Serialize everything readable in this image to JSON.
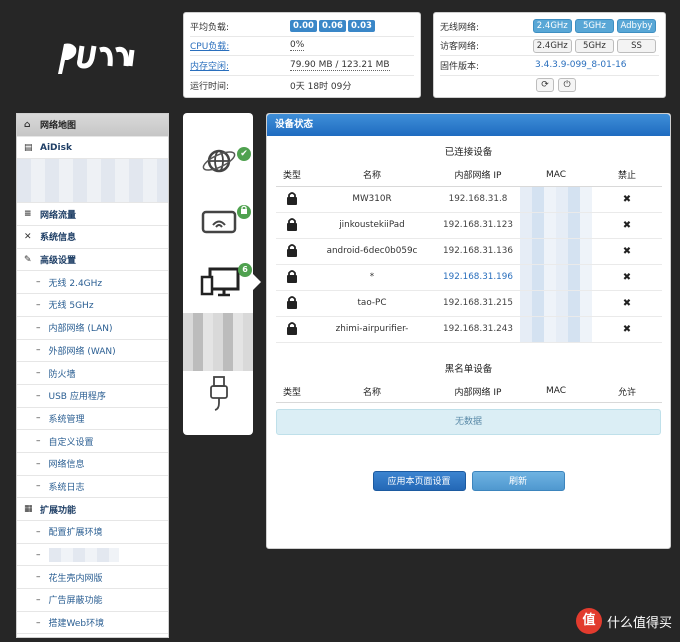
{
  "status": {
    "load_label": "平均负载:",
    "load_values": [
      "0.00",
      "0.06",
      "0.03"
    ],
    "cpu_label": "CPU负载:",
    "cpu_value": "0%",
    "mem_label": "内存空闲:",
    "mem_value": "79.90 MB / 123.21 MB",
    "uptime_label": "运行时间:",
    "uptime_value": "0天 18时 09分"
  },
  "wireless": {
    "wifi_label": "无线网络:",
    "wifi_buttons": [
      "2.4GHz",
      "5GHz",
      "Adbyby"
    ],
    "guest_label": "访客网络:",
    "guest_buttons": [
      "2.4GHz",
      "5GHz",
      "SS"
    ],
    "fw_label": "固件版本:",
    "fw_value": "3.4.3.9-099_8-01-16"
  },
  "sidebar": {
    "network_map": "网络地图",
    "aidisk": "AiDisk",
    "traffic": "网络流量",
    "sysinfo": "系统信息",
    "advanced": "高级设置",
    "advanced_items": [
      "无线 2.4GHz",
      "无线 5GHz",
      "内部网络 (LAN)",
      "外部网络 (WAN)",
      "防火墙",
      "USB 应用程序",
      "系统管理",
      "自定义设置",
      "网络信息",
      "系统日志"
    ],
    "extensions": "扩展功能",
    "extension_items": [
      "配置扩展环境",
      "",
      "花生壳内网版",
      "广告屏蔽功能",
      "搭建Web环境"
    ]
  },
  "device_icons": {
    "client_count": "6",
    "check_mark": "✔"
  },
  "main": {
    "title": "设备状态",
    "connected_title": "已连接设备",
    "columns": [
      "类型",
      "名称",
      "内部网络 IP",
      "MAC",
      "禁止"
    ],
    "devices": [
      {
        "name": "MW310R",
        "ip": "192.168.31.8",
        "link": false
      },
      {
        "name": "jinkoustekiiPad",
        "ip": "192.168.31.123",
        "link": false
      },
      {
        "name": "android-6dec0b059c",
        "ip": "192.168.31.136",
        "link": false
      },
      {
        "name": "*",
        "ip": "192.168.31.196",
        "link": true
      },
      {
        "name": "tao-PC",
        "ip": "192.168.31.215",
        "link": false
      },
      {
        "name": "zhimi-airpurifier-",
        "ip": "192.168.31.243",
        "link": false
      }
    ],
    "ban_mark": "✖",
    "blacklist_title": "黑名单设备",
    "blacklist_columns": [
      "类型",
      "名称",
      "内部网络 IP",
      "MAC",
      "允许"
    ],
    "no_data": "无数据",
    "apply_button": "应用本页面设置",
    "refresh_button": "刷新"
  },
  "watermark": {
    "badge": "值",
    "text": "什么值得买"
  },
  "colors": {
    "header_blue": "#1f6bc0",
    "link_blue": "#2a6fbd",
    "badge_green": "#4fa14f"
  }
}
